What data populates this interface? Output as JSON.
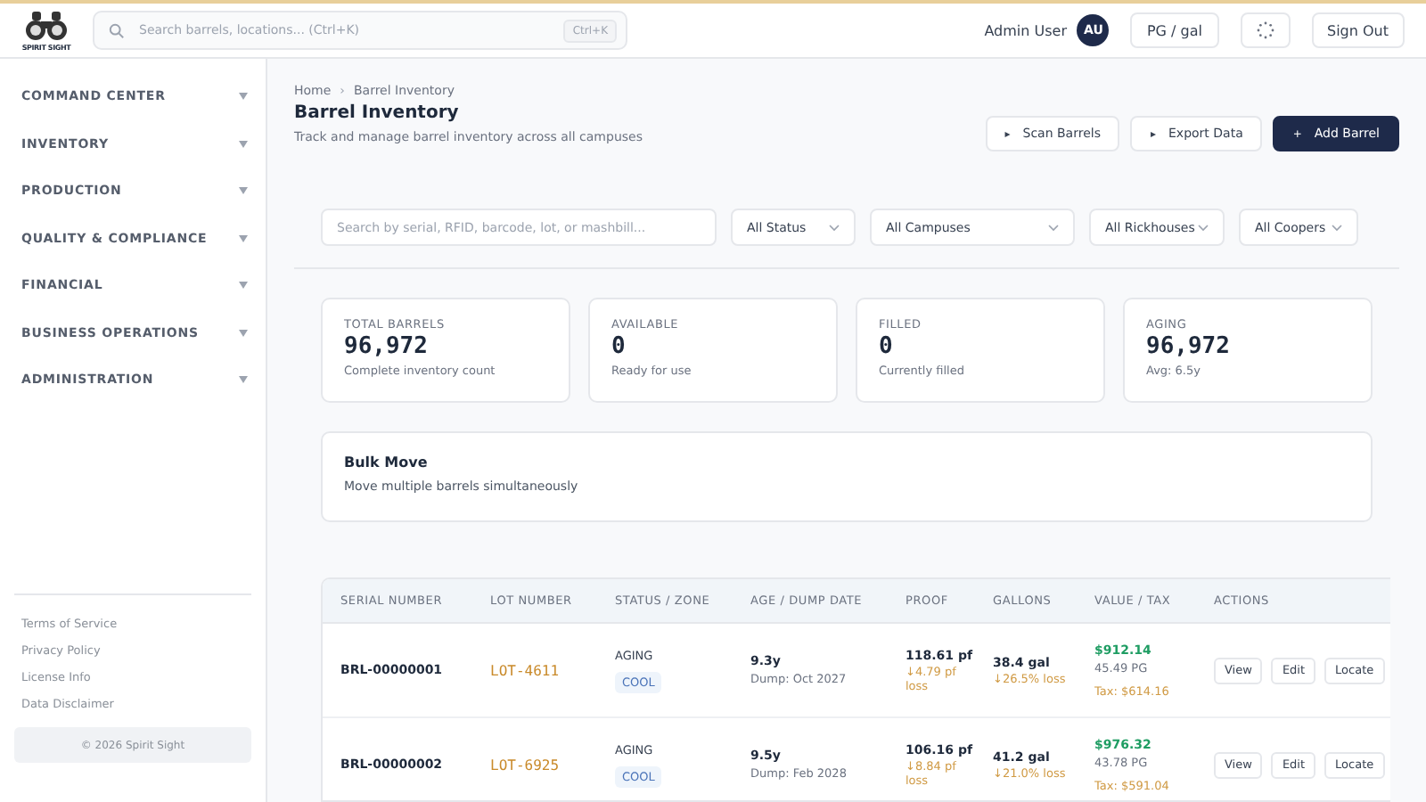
{
  "header": {
    "logo_text": "SPIRIT SIGHT",
    "search": {
      "placeholder": "Search barrels, locations... (Ctrl+K)",
      "shortcut": "Ctrl+K"
    },
    "user_name": "Admin User",
    "avatar": "AU",
    "unit_button": "PG / gal",
    "sign_out": "Sign Out"
  },
  "sidebar": {
    "items": [
      {
        "label": "COMMAND CENTER",
        "expanded": false
      },
      {
        "label": "INVENTORY",
        "expanded": false
      },
      {
        "label": "PRODUCTION",
        "expanded": false
      },
      {
        "label": "QUALITY & COMPLIANCE",
        "expanded": false
      },
      {
        "label": "FINANCIAL",
        "expanded": false
      },
      {
        "label": "BUSINESS OPERATIONS",
        "expanded": false
      },
      {
        "label": "ADMINISTRATION",
        "expanded": false
      }
    ],
    "footer_links": [
      "Terms of Service",
      "Privacy Policy",
      "License Info",
      "Data Disclaimer"
    ],
    "copyright": "© 2026 Spirit Sight"
  },
  "breadcrumb": [
    "Home",
    "Barrel Inventory"
  ],
  "breadcrumb_separator": "›",
  "page": {
    "title": "Barrel Inventory",
    "subtitle": "Track and manage barrel inventory across all campuses"
  },
  "actions": [
    {
      "label": "Scan Barrels",
      "icon": "▸",
      "kind": "secondary"
    },
    {
      "label": "Export Data",
      "icon": "▸",
      "kind": "secondary"
    },
    {
      "label": "Add Barrel",
      "icon": "+",
      "kind": "primary"
    }
  ],
  "filters": {
    "search": {
      "placeholder": "Search by serial, RFID, barcode, lot, or mashbill..."
    },
    "selects": [
      "All Status",
      "All Campuses",
      "All Rickhouses",
      "All Coopers"
    ]
  },
  "stats": [
    {
      "label": "TOTAL BARRELS",
      "value": "96,972",
      "caption": "Complete inventory count"
    },
    {
      "label": "AVAILABLE",
      "value": "0",
      "caption": "Ready for use"
    },
    {
      "label": "FILLED",
      "value": "0",
      "caption": "Currently filled"
    },
    {
      "label": "AGING",
      "value": "96,972",
      "caption": "Avg: 6.5y"
    }
  ],
  "bulk_move": {
    "title": "Bulk Move",
    "description": "Move multiple barrels simultaneously"
  },
  "table": {
    "columns": [
      "SERIAL NUMBER",
      "LOT NUMBER",
      "STATUS / ZONE",
      "AGE / DUMP DATE",
      "PROOF",
      "GALLONS",
      "VALUE / TAX",
      "ACTIONS"
    ],
    "rows": [
      {
        "serial": "BRL-00000001",
        "lot": "LOT-4611",
        "status": "AGING",
        "zone": "COOL",
        "age": "9.3y",
        "dump": "Dump: Oct 2027",
        "proof": "118.61 pf",
        "proof_loss": "↓4.79 pf loss",
        "gallons": "38.4 gal",
        "gallons_loss": "↓26.5% loss",
        "value": "$912.14",
        "pg": "45.49 PG",
        "tax": "Tax: $614.16",
        "buttons": [
          "View",
          "Edit",
          "Locate"
        ]
      },
      {
        "serial": "BRL-00000002",
        "lot": "LOT-6925",
        "status": "AGING",
        "zone": "COOL",
        "age": "9.5y",
        "dump": "Dump: Feb 2028",
        "proof": "106.16 pf",
        "proof_loss": "↓8.84 pf loss",
        "gallons": "41.2 gal",
        "gallons_loss": "↓21.0% loss",
        "value": "$976.32",
        "pg": "43.78 PG",
        "tax": "Tax: $591.04",
        "buttons": [
          "View",
          "Edit",
          "Locate"
        ]
      }
    ]
  }
}
